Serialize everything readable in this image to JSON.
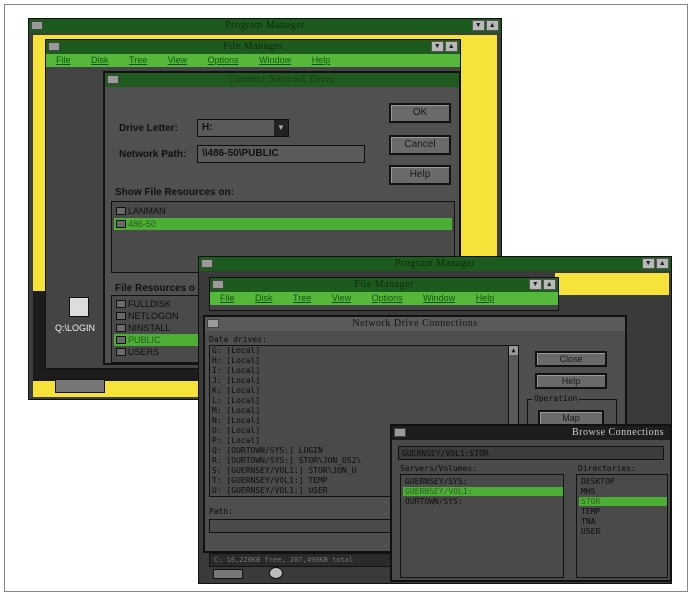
{
  "win1": {
    "pm_title": "Program Manager",
    "fm_title": "File Manager",
    "menu": [
      "File",
      "Disk",
      "Tree",
      "View",
      "Options",
      "Window",
      "Help"
    ],
    "dialog": {
      "title": "Connect Network Drive",
      "drive_letter_label": "Drive Letter:",
      "drive_letter_value": "H:",
      "network_path_label": "Network Path:",
      "network_path_value": "\\\\486-50\\PUBLIC",
      "show_resources_label": "Show File Resources on:",
      "servers": [
        "LANMAN",
        "486-50"
      ],
      "selected_server": "486-50",
      "file_resources_label": "File Resources o",
      "resources": [
        "FULLDISK",
        "NETLOGON",
        "NINSTALL",
        "PUBLIC",
        "USERS"
      ],
      "selected_resource": "PUBLIC",
      "buttons": {
        "ok": "OK",
        "cancel": "Cancel",
        "help": "Help"
      }
    },
    "icon_label": "Q:\\LOGIN"
  },
  "win2": {
    "pm_title": "Program Manager",
    "fm_title": "File Manager",
    "menu": [
      "File",
      "Disk",
      "Tree",
      "View",
      "Options",
      "Window",
      "Help"
    ],
    "dialog": {
      "title": "Network Drive Connections",
      "data_drives_label": "Data drives:",
      "drives": [
        "G:  [Local]",
        "H:  [Local]",
        "I:  [Local]",
        "J:  [Local]",
        "K:  [Local]",
        "L:  [Local]",
        "M:  [Local]",
        "N:  [Local]",
        "O:  [Local]",
        "P:  [Local]",
        "Q:  [OURTOWN/SYS:]  LOGIN",
        "R:  [OURTOWN/SYS:]  STOR\\JON_OS2\\",
        "S:  [GUERNSEY/VOL1:]  STOR\\JON_U",
        "T:  [GUERNSEY/VOL1:]  TEMP",
        "U:  [GUERNSEY/VOL1:]  USER"
      ],
      "path_label": "Path:",
      "buttons": {
        "close": "Close",
        "help": "Help"
      },
      "operation_label": "Operation",
      "operation_button": "Map"
    },
    "status": "C: 16,220KB free, 207,490KB total"
  },
  "browse": {
    "title": "Browse Connections",
    "path": "GUERNSEY/VOL1:STOR",
    "servers_label": "Servers/Volumes:",
    "servers": [
      "GUERNSEY/SYS:",
      "GUERNSEY/VOL1:",
      "OURTOWN/SYS:"
    ],
    "selected_server": "GUERNSEY/VOL1:",
    "dirs_label": "Directories:",
    "dirs": [
      "DESKTOP",
      "MHS",
      "STOR",
      "TEMP",
      "TNA",
      "USER"
    ],
    "selected_dir": "STOR"
  },
  "colors": {
    "accent_green": "#4cae34",
    "yellow": "#f7e23a",
    "dark_gray": "#3c3c3c"
  }
}
